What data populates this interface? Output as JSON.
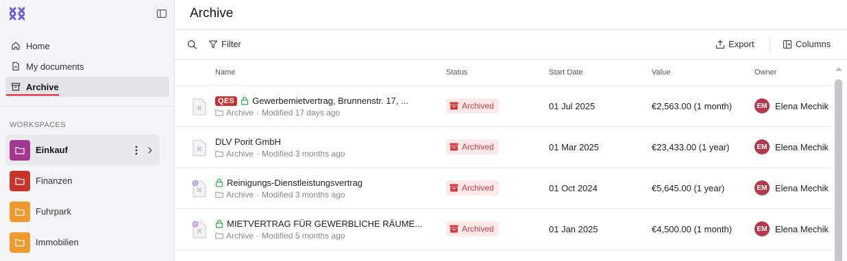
{
  "sidebar": {
    "nav": [
      {
        "label": "Home",
        "icon": "home-icon"
      },
      {
        "label": "My documents",
        "icon": "document-icon"
      },
      {
        "label": "Archive",
        "icon": "archive-icon",
        "active": true
      }
    ],
    "workspaces_heading": "WORKSPACES",
    "workspaces": [
      {
        "label": "Einkauf",
        "color": "#a3398f",
        "selected": true
      },
      {
        "label": "Finanzen",
        "color": "#c9342a"
      },
      {
        "label": "Fuhrpark",
        "color": "#ee9a2d"
      },
      {
        "label": "Immobilien",
        "color": "#ee9a2d"
      }
    ]
  },
  "main": {
    "title": "Archive",
    "toolbar": {
      "filter_label": "Filter",
      "export_label": "Export",
      "columns_label": "Columns"
    },
    "columns": [
      "Name",
      "Status",
      "Start Date",
      "Value",
      "Owner"
    ],
    "rows": [
      {
        "qes": "QES",
        "name": "Gewerbemietvertrag, Brunnenstr. 17, ...",
        "folder": "Archive",
        "modified": "Modified 17 days ago",
        "status": "Archived",
        "start_date": "01 Jul 2025",
        "value": "€2,563.00 (1 month)",
        "owner_initials": "EM",
        "owner_name": "Elena Mechik",
        "locked": true,
        "badge": false
      },
      {
        "name": "DLV Porit GmbH",
        "folder": "Archive",
        "modified": "Modified 3 months ago",
        "status": "Archived",
        "start_date": "01 Mar 2025",
        "value": "€23,433.00 (1 year)",
        "owner_initials": "EM",
        "owner_name": "Elena Mechik",
        "locked": false,
        "badge": false
      },
      {
        "name": "Reinigungs-Dienstleistungsvertrag",
        "folder": "Archive",
        "modified": "Modified 3 months ago",
        "status": "Archived",
        "start_date": "01 Oct 2024",
        "value": "€5,645.00 (1 year)",
        "owner_initials": "EM",
        "owner_name": "Elena Mechik",
        "locked": true,
        "badge": true
      },
      {
        "name": "MIETVERTRAG FÜR GEWERBLICHE RÄUME...",
        "folder": "Archive",
        "modified": "Modified 5 months ago",
        "status": "Archived",
        "start_date": "01 Jan 2025",
        "value": "€4,500.00 (1 month)",
        "owner_initials": "EM",
        "owner_name": "Elena Mechik",
        "locked": true,
        "badge": true
      }
    ]
  },
  "colors": {
    "accent_red": "#e0242b",
    "status_red": "#d2393c",
    "avatar": "#b3394d"
  }
}
